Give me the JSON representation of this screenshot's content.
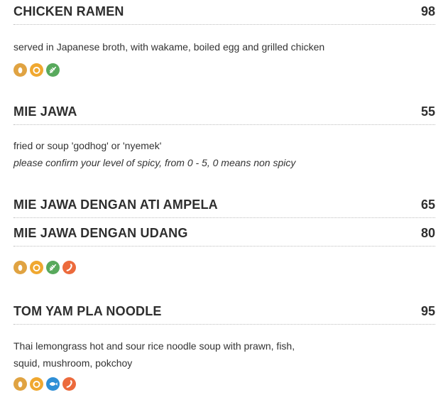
{
  "items": [
    {
      "name": "CHICKEN RAMEN",
      "price": "98",
      "description": "served in Japanese broth, with wakame, boiled egg and grilled chicken",
      "icons": [
        "egg-icon",
        "sesame-icon",
        "celery-icon"
      ]
    },
    {
      "name": "MIE JAWA",
      "price": "55",
      "description": "fried or soup 'godhog' or 'nyemek'",
      "note": "please confirm your level of spicy, from 0 - 5, 0 means non spicy"
    },
    {
      "name": "MIE JAWA DENGAN ATI AMPELA",
      "price": "65"
    },
    {
      "name": "MIE JAWA DENGAN UDANG",
      "price": "80",
      "icons": [
        "egg-icon",
        "sesame-icon",
        "celery-icon",
        "chili-icon"
      ]
    },
    {
      "name": "TOM YAM PLA NOODLE",
      "price": "95",
      "description_line1": "Thai lemongrass hot and sour rice noodle soup with prawn, fish,",
      "description_line2": "squid, mushroom, pokchoy",
      "icons": [
        "egg-icon",
        "sesame-icon",
        "fish-icon",
        "chili-icon"
      ]
    }
  ],
  "icon_colors": {
    "egg-icon": "#e0a342",
    "sesame-icon": "#f0a830",
    "celery-icon": "#58a95c",
    "chili-icon": "#ec6a3c",
    "fish-icon": "#2f8fd6"
  }
}
